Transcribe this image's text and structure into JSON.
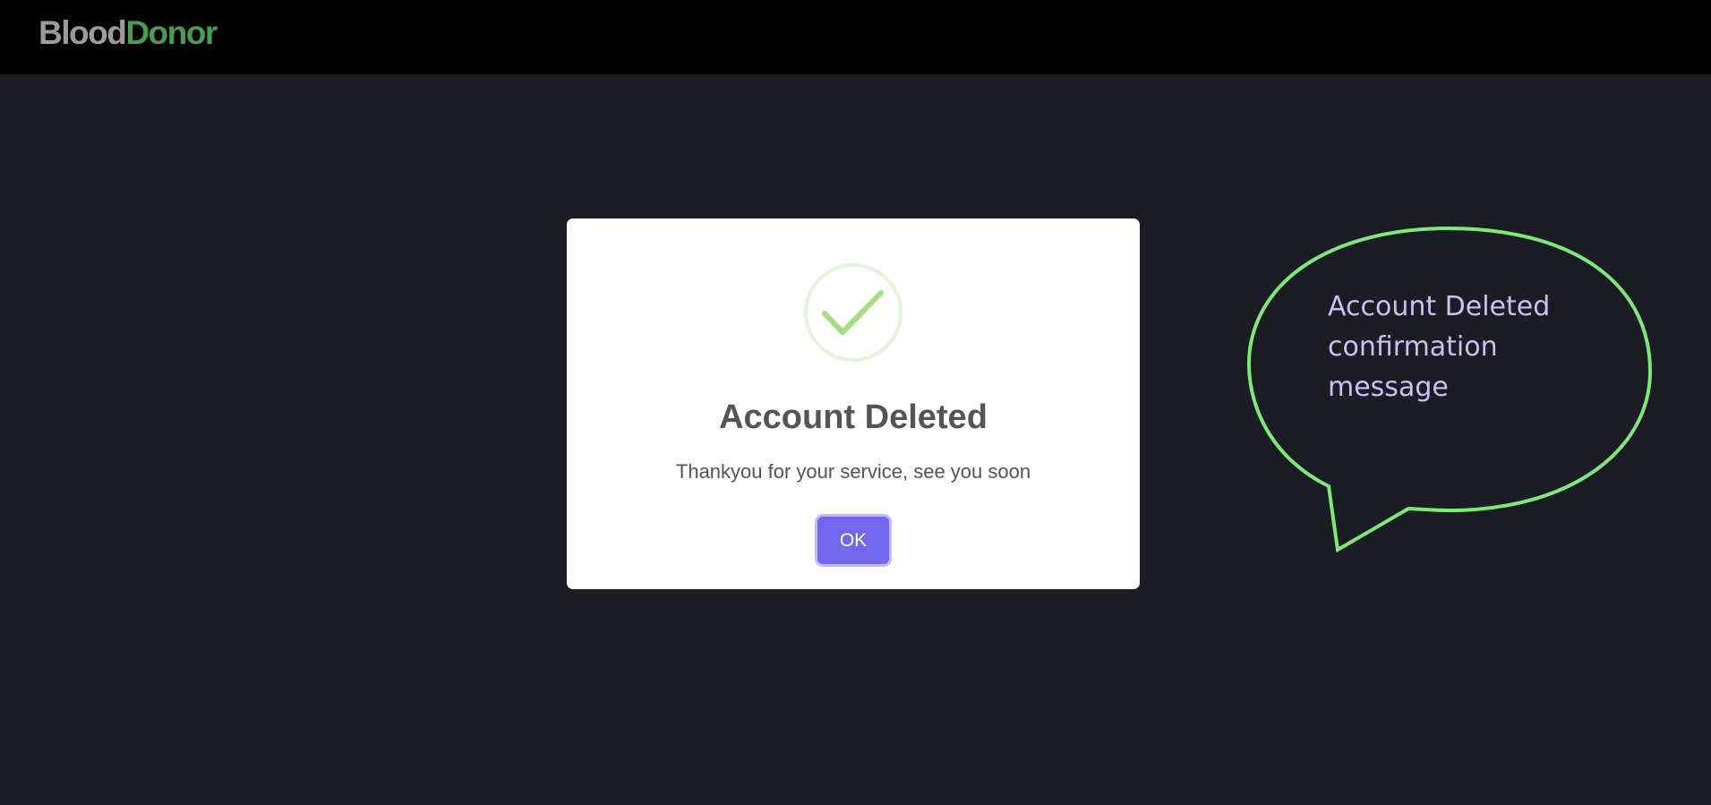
{
  "header": {
    "brand_part1": "Blood",
    "brand_part2": "Donor"
  },
  "dialog": {
    "icon": "success-check-icon",
    "title": "Account Deleted",
    "message": "Thankyou for your service, see you soon",
    "ok_label": "OK"
  },
  "annotation": {
    "lines": [
      "Account Deleted",
      "confirmation",
      "message"
    ]
  },
  "colors": {
    "page_background": "#1b1c24",
    "navbar": "#000000",
    "brand_gray": "#9c9c9c",
    "brand_green": "#4e9a52",
    "ok_button": "#7367f0",
    "success_green": "#a5dc86",
    "callout_outline": "#7ee87a",
    "callout_text": "#cdbff2"
  }
}
